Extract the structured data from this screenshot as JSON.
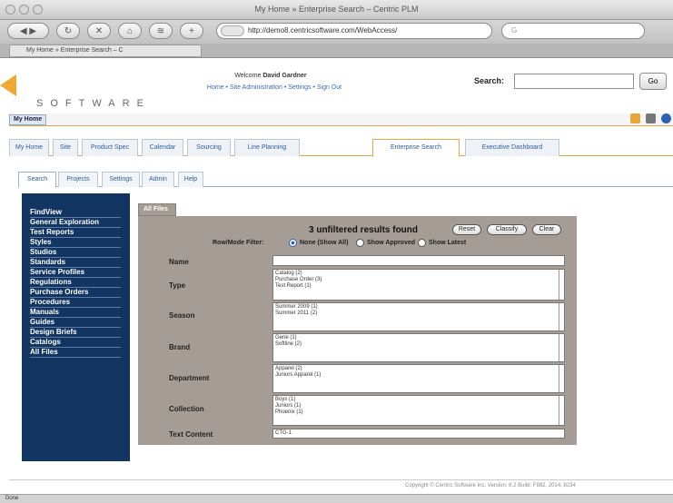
{
  "window": {
    "title": "My Home » Enterprise Search – Centric PLM"
  },
  "browser": {
    "url": "http://demo8.centricsoftware.com/WebAccess/",
    "tab_title": "My Home » Enterprise Search – C",
    "status": "Done"
  },
  "header": {
    "logo_text": "SOFTWARE",
    "welcome_prefix": "Welcome",
    "user_name": "David Gardner",
    "links": "Home • Site Administration • Settings • Sign Out",
    "search_label": "Search:",
    "search_value": "",
    "go_label": "Go"
  },
  "breadcrumb": {
    "label": "My Home"
  },
  "main_tabs": [
    {
      "label": "My Home"
    },
    {
      "label": "Site"
    },
    {
      "label": "Product Spec"
    },
    {
      "label": "Calendar"
    },
    {
      "label": "Sourcing"
    },
    {
      "label": "Line Planning"
    },
    {
      "label": "Enterprise Search"
    },
    {
      "label": "Executive Dashboard"
    }
  ],
  "sub_tabs": [
    {
      "label": "Search"
    },
    {
      "label": "Projects"
    },
    {
      "label": "Settings"
    },
    {
      "label": "Admin"
    },
    {
      "label": "Help"
    }
  ],
  "sidebar": {
    "items": [
      {
        "label": "FindView"
      },
      {
        "label": "General Exploration"
      },
      {
        "label": "Test Reports"
      },
      {
        "label": "Styles"
      },
      {
        "label": "Studios"
      },
      {
        "label": "Standards"
      },
      {
        "label": "Service Profiles"
      },
      {
        "label": "Regulations"
      },
      {
        "label": "Purchase Orders"
      },
      {
        "label": "Procedures"
      },
      {
        "label": "Manuals"
      },
      {
        "label": "Guides"
      },
      {
        "label": "Design Briefs"
      },
      {
        "label": "Catalogs"
      },
      {
        "label": "All Files"
      }
    ]
  },
  "content": {
    "tab_label": "All Files",
    "results_text": "3 unfiltered results found",
    "buttons": {
      "reset": "Reset",
      "classify": "Classify",
      "clear": "Clear"
    },
    "filter_label": "Row/Mode Filter:",
    "radio_options": [
      {
        "label": "None (Show All)",
        "selected": true
      },
      {
        "label": "Show Approved",
        "selected": false
      },
      {
        "label": "Show Latest",
        "selected": false
      }
    ],
    "fields": {
      "name": {
        "label": "Name",
        "value": ""
      },
      "type": {
        "label": "Type",
        "options": [
          "Catalog (2)",
          "Purchase Order (3)",
          "Test Report (1)"
        ]
      },
      "season": {
        "label": "Season",
        "options": [
          "Summer 2009 (1)",
          "Summer 2011 (2)"
        ]
      },
      "brand": {
        "label": "Brand",
        "options": [
          "Gene (1)",
          "Softline (2)"
        ]
      },
      "department": {
        "label": "Department",
        "options": [
          "Apparel (2)",
          "Juniors Apparel (1)"
        ]
      },
      "collection": {
        "label": "Collection",
        "options": [
          "Boys (1)",
          "Juniors (1)",
          "Phoenix (1)"
        ]
      },
      "text_content": {
        "label": "Text Content",
        "value": "CTG-1"
      }
    }
  },
  "footer": {
    "text": "Copyright © Centric Software Inc.   Version: 8.2   Build: F982, 2014, 8234"
  },
  "colors": {
    "sidebar": "#123561",
    "panel": "#a59d95",
    "accent": "#e3a64a",
    "link": "#2e5b9c"
  }
}
